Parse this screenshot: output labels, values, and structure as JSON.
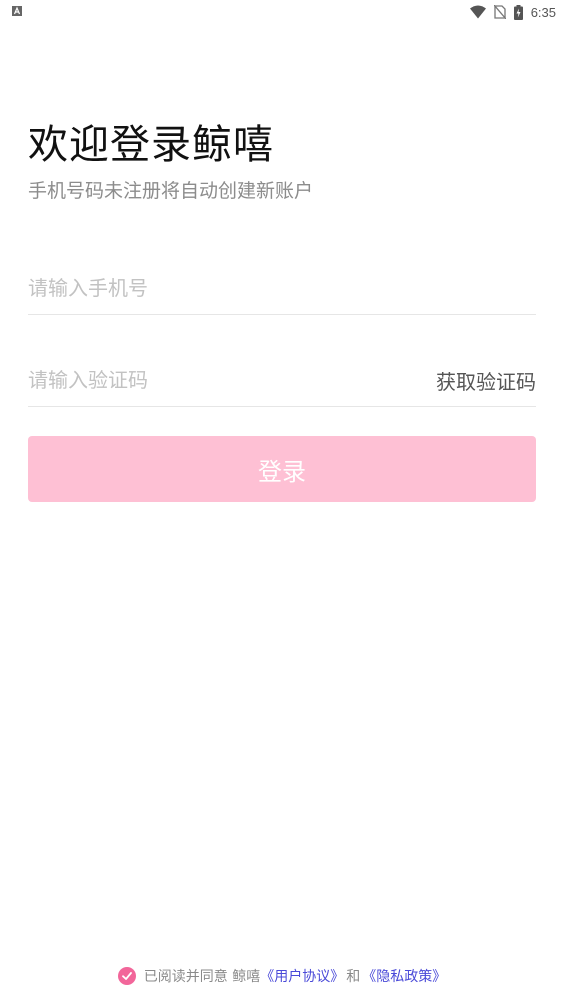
{
  "status_bar": {
    "time": "6:35",
    "icons": [
      "notification-a-icon",
      "wifi-icon",
      "no-sim-icon",
      "battery-charging-icon"
    ]
  },
  "header": {
    "title": "欢迎登录鲸嘻",
    "subtitle": "手机号码未注册将自动创建新账户"
  },
  "form": {
    "phone_placeholder": "请输入手机号",
    "phone_value": "",
    "code_placeholder": "请输入验证码",
    "code_value": "",
    "get_code_label": "获取验证码",
    "login_label": "登录"
  },
  "agreement": {
    "checked": true,
    "prefix": "已阅读并同意 鲸嘻",
    "user_agreement": "《用户协议》",
    "and": "和",
    "privacy_policy": "《隐私政策》"
  },
  "colors": {
    "accent_pink": "#fec0d4",
    "check_pink": "#f2669a",
    "link_blue": "#4a4ad8"
  }
}
